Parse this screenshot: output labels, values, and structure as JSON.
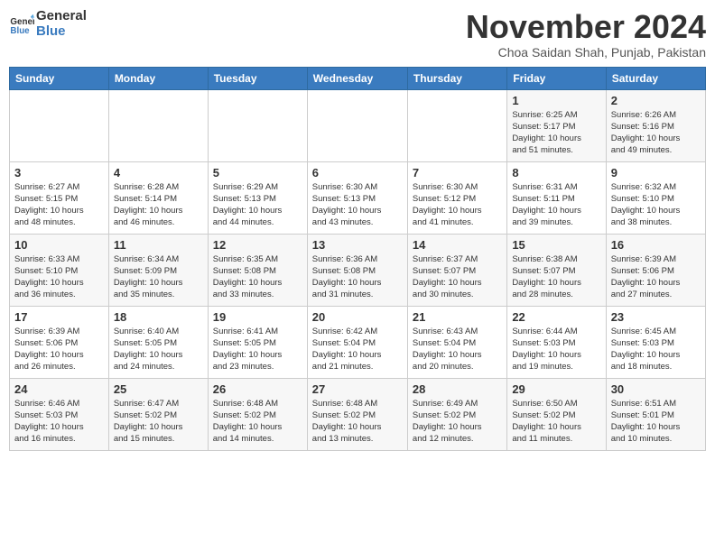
{
  "header": {
    "logo_general": "General",
    "logo_blue": "Blue",
    "month": "November 2024",
    "location": "Choa Saidan Shah, Punjab, Pakistan"
  },
  "weekdays": [
    "Sunday",
    "Monday",
    "Tuesday",
    "Wednesday",
    "Thursday",
    "Friday",
    "Saturday"
  ],
  "weeks": [
    [
      {
        "day": "",
        "info": ""
      },
      {
        "day": "",
        "info": ""
      },
      {
        "day": "",
        "info": ""
      },
      {
        "day": "",
        "info": ""
      },
      {
        "day": "",
        "info": ""
      },
      {
        "day": "1",
        "info": "Sunrise: 6:25 AM\nSunset: 5:17 PM\nDaylight: 10 hours\nand 51 minutes."
      },
      {
        "day": "2",
        "info": "Sunrise: 6:26 AM\nSunset: 5:16 PM\nDaylight: 10 hours\nand 49 minutes."
      }
    ],
    [
      {
        "day": "3",
        "info": "Sunrise: 6:27 AM\nSunset: 5:15 PM\nDaylight: 10 hours\nand 48 minutes."
      },
      {
        "day": "4",
        "info": "Sunrise: 6:28 AM\nSunset: 5:14 PM\nDaylight: 10 hours\nand 46 minutes."
      },
      {
        "day": "5",
        "info": "Sunrise: 6:29 AM\nSunset: 5:13 PM\nDaylight: 10 hours\nand 44 minutes."
      },
      {
        "day": "6",
        "info": "Sunrise: 6:30 AM\nSunset: 5:13 PM\nDaylight: 10 hours\nand 43 minutes."
      },
      {
        "day": "7",
        "info": "Sunrise: 6:30 AM\nSunset: 5:12 PM\nDaylight: 10 hours\nand 41 minutes."
      },
      {
        "day": "8",
        "info": "Sunrise: 6:31 AM\nSunset: 5:11 PM\nDaylight: 10 hours\nand 39 minutes."
      },
      {
        "day": "9",
        "info": "Sunrise: 6:32 AM\nSunset: 5:10 PM\nDaylight: 10 hours\nand 38 minutes."
      }
    ],
    [
      {
        "day": "10",
        "info": "Sunrise: 6:33 AM\nSunset: 5:10 PM\nDaylight: 10 hours\nand 36 minutes."
      },
      {
        "day": "11",
        "info": "Sunrise: 6:34 AM\nSunset: 5:09 PM\nDaylight: 10 hours\nand 35 minutes."
      },
      {
        "day": "12",
        "info": "Sunrise: 6:35 AM\nSunset: 5:08 PM\nDaylight: 10 hours\nand 33 minutes."
      },
      {
        "day": "13",
        "info": "Sunrise: 6:36 AM\nSunset: 5:08 PM\nDaylight: 10 hours\nand 31 minutes."
      },
      {
        "day": "14",
        "info": "Sunrise: 6:37 AM\nSunset: 5:07 PM\nDaylight: 10 hours\nand 30 minutes."
      },
      {
        "day": "15",
        "info": "Sunrise: 6:38 AM\nSunset: 5:07 PM\nDaylight: 10 hours\nand 28 minutes."
      },
      {
        "day": "16",
        "info": "Sunrise: 6:39 AM\nSunset: 5:06 PM\nDaylight: 10 hours\nand 27 minutes."
      }
    ],
    [
      {
        "day": "17",
        "info": "Sunrise: 6:39 AM\nSunset: 5:06 PM\nDaylight: 10 hours\nand 26 minutes."
      },
      {
        "day": "18",
        "info": "Sunrise: 6:40 AM\nSunset: 5:05 PM\nDaylight: 10 hours\nand 24 minutes."
      },
      {
        "day": "19",
        "info": "Sunrise: 6:41 AM\nSunset: 5:05 PM\nDaylight: 10 hours\nand 23 minutes."
      },
      {
        "day": "20",
        "info": "Sunrise: 6:42 AM\nSunset: 5:04 PM\nDaylight: 10 hours\nand 21 minutes."
      },
      {
        "day": "21",
        "info": "Sunrise: 6:43 AM\nSunset: 5:04 PM\nDaylight: 10 hours\nand 20 minutes."
      },
      {
        "day": "22",
        "info": "Sunrise: 6:44 AM\nSunset: 5:03 PM\nDaylight: 10 hours\nand 19 minutes."
      },
      {
        "day": "23",
        "info": "Sunrise: 6:45 AM\nSunset: 5:03 PM\nDaylight: 10 hours\nand 18 minutes."
      }
    ],
    [
      {
        "day": "24",
        "info": "Sunrise: 6:46 AM\nSunset: 5:03 PM\nDaylight: 10 hours\nand 16 minutes."
      },
      {
        "day": "25",
        "info": "Sunrise: 6:47 AM\nSunset: 5:02 PM\nDaylight: 10 hours\nand 15 minutes."
      },
      {
        "day": "26",
        "info": "Sunrise: 6:48 AM\nSunset: 5:02 PM\nDaylight: 10 hours\nand 14 minutes."
      },
      {
        "day": "27",
        "info": "Sunrise: 6:48 AM\nSunset: 5:02 PM\nDaylight: 10 hours\nand 13 minutes."
      },
      {
        "day": "28",
        "info": "Sunrise: 6:49 AM\nSunset: 5:02 PM\nDaylight: 10 hours\nand 12 minutes."
      },
      {
        "day": "29",
        "info": "Sunrise: 6:50 AM\nSunset: 5:02 PM\nDaylight: 10 hours\nand 11 minutes."
      },
      {
        "day": "30",
        "info": "Sunrise: 6:51 AM\nSunset: 5:01 PM\nDaylight: 10 hours\nand 10 minutes."
      }
    ]
  ]
}
